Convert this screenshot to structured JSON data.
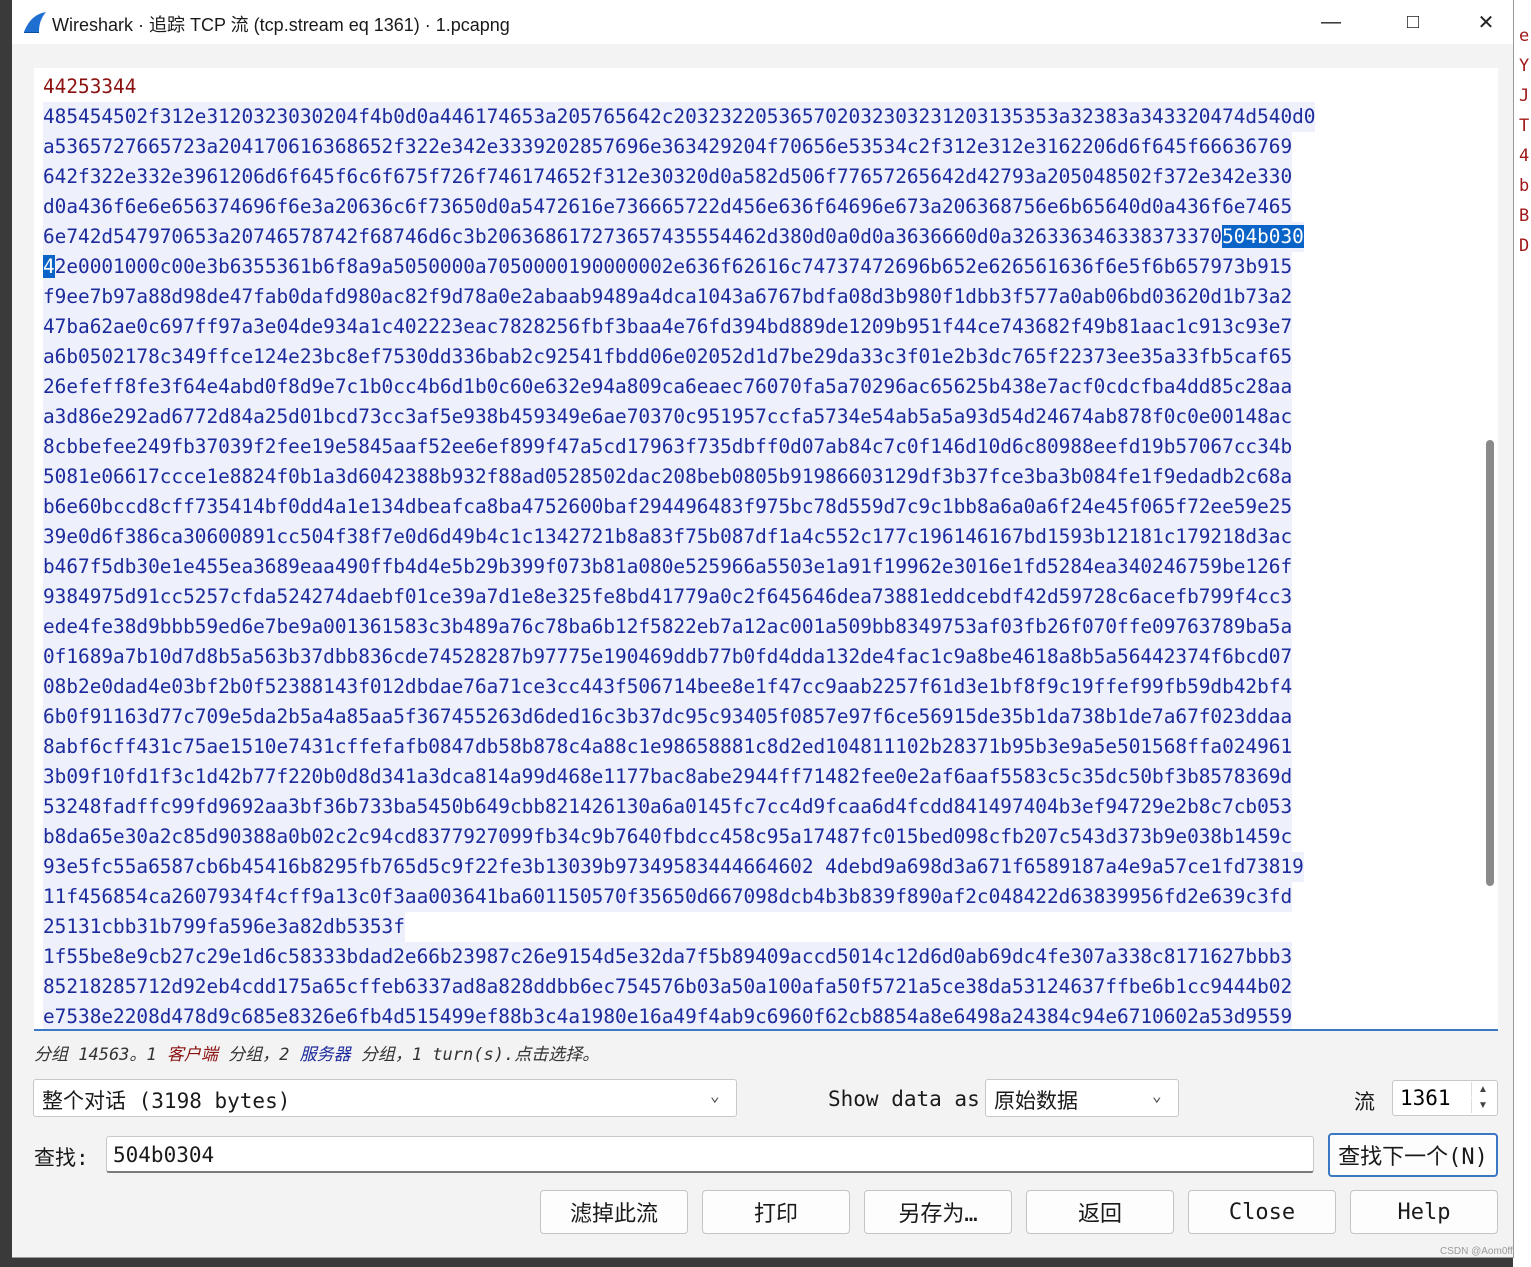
{
  "window": {
    "title": "Wireshark · 追踪 TCP 流 (tcp.stream eq 1361) · 1.pcapng",
    "minimize_icon": "minimize-icon",
    "maximize_icon": "maximize-icon",
    "close_icon": "close-icon"
  },
  "background_edge_chars": [
    "e",
    "Y",
    "J",
    "T",
    "4",
    "b",
    "B",
    "D"
  ],
  "stream": {
    "client_line": "44253344",
    "server_block_1": [
      "485454502f312e3120323030204f4b0d0a446174653a205765642c203232205365702032303231203135353a32383a343320474d540d0",
      "a5365727665723a204170616368652f322e342e3339202857696e363429204f70656e53534c2f312e312e3162206d6f645f66636769",
      "642f322e332e3961206d6f645f6c6f675f726f746174652f312e30320d0a582d506f77657265642d42793a205048502f372e342e330",
      "d0a436f6e6e656374696f6e3a20636c6f73650d0a5472616e736665722d456e636f64696e673a206368756e6b65640d0a436f6e7465",
      "6e742d547970653a20746578742f68746d6c3b206368617273657435554462d380d0a0d0a3636660d0a326336346338373370",
      "e0001000c00e3b6355361b6f8a9a5050000a7050000190000002e636f62616c74737472696b652e626561636f6e5f6b657973b915",
      "f9ee7b97a88d98de47fab0dafd980ac82f9d78a0e2abaab9489a4dca1043a6767bdfa08d3b980f1dbb3f577a0ab06bd03620d1b73a2",
      "47ba62ae0c697ff97a3e04de934a1c402223eac7828256fbf3baa4e76fd394bd889de1209b951f44ce743682f49b81aac1c913c93e7",
      "a6b0502178c349ffce124e23bc8ef7530dd336bab2c92541fbdd06e02052d1d7be29da33c3f01e2b3dc765f22373ee35a33fb5caf65",
      "26efeff8fe3f64e4abd0f8d9e7c1b0cc4b6d1b0c60e632e94a809ca6eaec76070fa5a70296ac65625b438e7acf0cdcfba4dd85c28aa",
      "a3d86e292ad6772d84a25d01bcd73cc3af5e938b459349e6ae70370c951957ccfa5734e54ab5a5a93d54d24674ab878f0c0e00148ac",
      "8cbbefee249fb37039f2fee19e5845aaf52ee6ef899f47a5cd17963f735dbff0d07ab84c7c0f146d10d6c80988eefd19b57067cc34b",
      "5081e06617ccce1e8824f0b1a3d6042388b932f88ad0528502dac208beb0805b91986603129df3b37fce3ba3b084fe1f9edadb2c68a",
      "b6e60bccd8cff735414bf0dd4a1e134dbeafca8ba4752600baf294496483f975bc78d559d7c9c1bb8a6a0a6f24e45f065f72ee59e25",
      "39e0d6f386ca30600891cc504f38f7e0d6d49b4c1c1342721b8a83f75b087df1a4c552c177c196146167bd1593b12181c179218d3ac",
      "b467f5db30e1e455ea3689eaa490ffb4d4e5b29b399f073b81a080e525966a5503e1a91f19962e3016e1fd5284ea340246759be126f",
      "9384975d91cc5257cfda524274daebf01ce39a7d1e8e325fe8bd41779a0c2f645646dea73881eddcebdf42d59728c6acefb799f4cc3",
      "ede4fe38d9bbb59ed6e7be9a001361583c3b489a76c78ba6b12f5822eb7a12ac001a509bb8349753af03fb26f070ffe09763789ba5a",
      "0f1689a7b10d7d8b5a563b37dbb836cde74528287b97775e190469ddb77b0fd4dda132de4fac1c9a8be4618a8b5a56442374f6bcd07",
      "08b2e0dad4e03bf2b0f52388143f012dbdae76a71ce3cc443f506714bee8e1f47cc9aab2257f61d3e1bf8f9c19ffef99fb59db42bf4",
      "6b0f91163d77c709e5da2b5a4a85aa5f367455263d6ded16c3b37dc95c93405f0857e97f6ce56915de35b1da738b1de7a67f023ddaa",
      "8abf6cff431c75ae1510e7431cffefafb0847db58b878c4a88c1e98658881c8d2ed104811102b28371b95b3e9a5e501568ffa024961",
      "3b09f10fd1f3c1d42b77f220b0d8d341a3dca814a99d468e1177bac8abe2944ff71482fee0e2af6aaf5583c5c35dc50bf3b8578369d",
      "53248fadffc99fd9692aa3bf36b733ba5450b649cbb821426130a6a0145fc7cc4d9fcaa6d4fcdd841497404b3ef94729e2b8c7cb053",
      "b8da65e30a2c85d90388a0b02c2c94cd8377927099fb34c9b7640fbdcc458c95a17487fc015bed098cfb207c543d373b9e038b1459c",
      "93e5fc55a6587cb6b45416b8295fb765d5c9f22fe3b13039b97349583444664602 4debd9a698d3a671f6589187a4e9a57ce1fd73819",
      "11f456854ca2607934f4cff9a13c0f3aa003641ba601150570f35650d667098dcb4b3b839f890af2c048422d63839956fd2e639c3fd",
      "25131cbb31b799fa596e3a82db5353f"
    ],
    "line5_highlight": "504b030",
    "line6_highlight": "4",
    "line6_rest": "2e0001000c00e3b6355361b6f8a9a5050000a7050000190000002e636f62616c74737472696b652e626561636f6e5f6b657973b915",
    "server_block_2": [
      "1f55be8e9cb27c29e1d6c58333bdad2e66b23987c26e9154d5e32da7f5b89409accd5014c12d6d0ab69dc4fe307a338c8171627bbb3",
      "85218285712d92eb4cdd175a65cffeb6337ad8a828ddbb6ec754576b03a50a100afa50f5721a5ce38da53124637ffbe6b1cc9444b02",
      "e7538e2208d478d9c685e8326e6fb4d515499ef88b3c4a1980e16a49f4ab9c6960f62cb8854a8e6498a24384c94e6710602a53d9559"
    ]
  },
  "status": {
    "part1": "分组 14563。1 ",
    "client_label": "客户端",
    "part2": " 分组，2 ",
    "server_label": "服务器",
    "part3": " 分组，1 turn(s).点击选择。"
  },
  "conversation_select": {
    "value": "整个对话 (3198 bytes)"
  },
  "show_data_as": {
    "label": "Show data as",
    "value": "原始数据"
  },
  "stream_number": {
    "label": "流",
    "value": "1361"
  },
  "find": {
    "label": "查找:",
    "value": "504b0304",
    "next_button": "查找下一个(N)"
  },
  "buttons": {
    "filter_out": "滤掉此流",
    "print": "打印",
    "save_as": "另存为…",
    "back": "返回",
    "close": "Close",
    "help": "Help"
  },
  "watermark": "CSDN @Aom0ff",
  "colors": {
    "client_text": "#8b1010",
    "server_text": "#1b2a9c",
    "server_bg": "#eef0fb",
    "highlight_bg": "#0a64c8",
    "accent": "#3a78c4"
  }
}
